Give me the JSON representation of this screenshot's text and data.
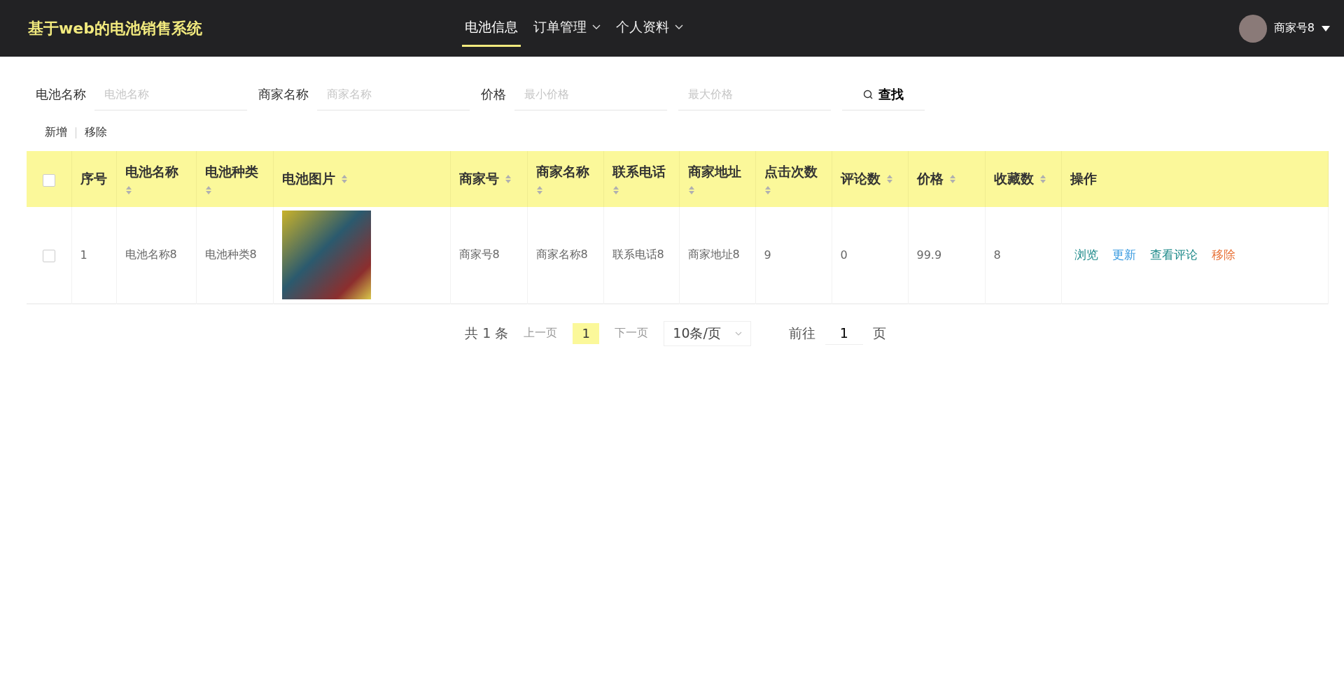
{
  "header": {
    "title": "基于web的电池销售系统",
    "nav": [
      {
        "label": "电池信息",
        "selected": true,
        "dropdown": false
      },
      {
        "label": "订单管理",
        "selected": false,
        "dropdown": true
      },
      {
        "label": "个人资料",
        "selected": false,
        "dropdown": true
      }
    ],
    "user": {
      "name": "商家号8"
    }
  },
  "filters": [
    {
      "label": "电池名称",
      "fields": [
        {
          "placeholder": "电池名称"
        }
      ]
    },
    {
      "label": "商家名称",
      "fields": [
        {
          "placeholder": "商家名称"
        }
      ]
    },
    {
      "label": "价格",
      "fields": [
        {
          "placeholder": "最小价格"
        },
        {
          "placeholder": "最大价格"
        }
      ]
    }
  ],
  "search_button": "查找",
  "toolbar": [
    "新增",
    "移除"
  ],
  "table": {
    "select_all": {
      "checked": false
    },
    "columns": [
      {
        "label": "序号",
        "sortable": false
      },
      {
        "label": "电池名称",
        "sortable": true
      },
      {
        "label": "电池种类",
        "sortable": true
      },
      {
        "label": "电池图片",
        "sortable": true
      },
      {
        "label": "商家号",
        "sortable": true
      },
      {
        "label": "商家名称",
        "sortable": true
      },
      {
        "label": "联系电话",
        "sortable": true
      },
      {
        "label": "商家地址",
        "sortable": true
      },
      {
        "label": "点击次数",
        "sortable": true
      },
      {
        "label": "评论数",
        "sortable": true
      },
      {
        "label": "价格",
        "sortable": true
      },
      {
        "label": "收藏数",
        "sortable": true
      },
      {
        "label": "操作",
        "sortable": false
      }
    ],
    "rows": [
      {
        "checked": false,
        "cells": [
          {
            "kind": "text",
            "text": "1"
          },
          {
            "kind": "text",
            "text": "电池名称8"
          },
          {
            "kind": "text",
            "text": "电池种类8"
          },
          {
            "kind": "image"
          },
          {
            "kind": "text",
            "text": "商家号8"
          },
          {
            "kind": "text",
            "text": "商家名称8"
          },
          {
            "kind": "text",
            "text": "联系电话8"
          },
          {
            "kind": "text",
            "text": "商家地址8"
          },
          {
            "kind": "text",
            "text": "9"
          },
          {
            "kind": "text",
            "text": "0"
          },
          {
            "kind": "text",
            "text": "99.9"
          },
          {
            "kind": "text",
            "text": "8"
          },
          {
            "kind": "actions",
            "actions": [
              {
                "label": "浏览",
                "color": "#1e8a8a"
              },
              {
                "label": "更新",
                "color": "#3a9be0"
              },
              {
                "label": "查看评论",
                "color": "#1e8a8a"
              },
              {
                "label": "移除",
                "color": "#e8743b"
              }
            ]
          }
        ]
      }
    ]
  },
  "pagination": {
    "total": "共 1 条",
    "prev": "上一页",
    "pages": [
      {
        "label": "1",
        "selected": true
      }
    ],
    "next": "下一页",
    "page_size": "10条/页",
    "goto_label": "前往",
    "goto_value": "1",
    "goto_suffix": "页"
  }
}
